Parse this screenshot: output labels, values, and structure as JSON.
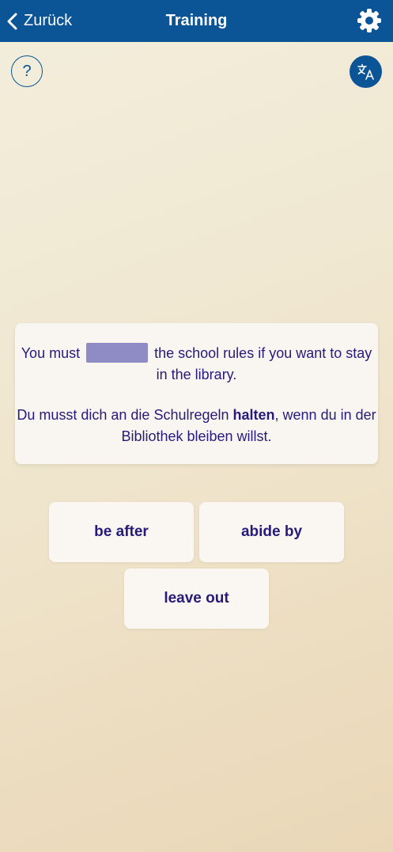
{
  "header": {
    "back_label": "Zurück",
    "title": "Training",
    "back_icon": "chevron-left-icon",
    "settings_icon": "gear-icon",
    "background_color": "#0b5496"
  },
  "help_button": {
    "label": "?"
  },
  "translate_button": {
    "icon": "translate-icon"
  },
  "sentence": {
    "english_before": "You must",
    "english_after": "the school rules if you want to stay in the library.",
    "german_before": "Du musst dich an die Schulregeln ",
    "german_highlight": "halten",
    "german_after": ", wenn du in der Bibliothek bleiben willst.",
    "text_color": "#261b7a",
    "blank_color": "#8f8bc4"
  },
  "answers": [
    {
      "label": "be after"
    },
    {
      "label": "abide by"
    },
    {
      "label": "leave out"
    }
  ]
}
